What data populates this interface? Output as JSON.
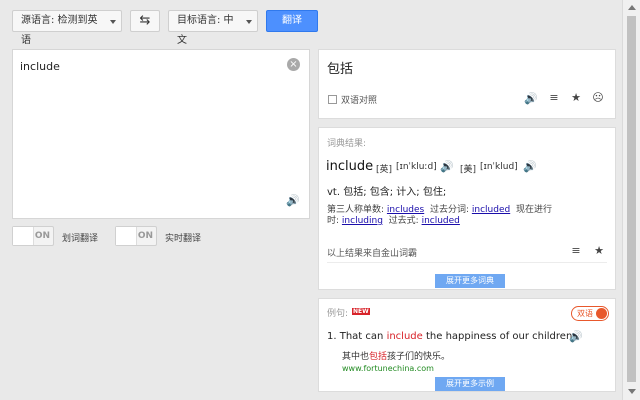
{
  "toolbar": {
    "source_lang": "源语言: 检测到英语",
    "swap_icon": "⇆",
    "target_lang": "目标语言: 中文",
    "translate_label": "翻译"
  },
  "source": {
    "text": "include",
    "clear_icon": "×",
    "speaker_icon": "🔊"
  },
  "options": [
    {
      "toggle": "ON",
      "label": "划词翻译"
    },
    {
      "toggle": "ON",
      "label": "实时翻译"
    }
  ],
  "result": {
    "text": "包括",
    "bilingual_label": "双语对照",
    "speaker_icon": "🔊",
    "list_icon": "≡",
    "star_icon": "★",
    "feedback_icon": "☹"
  },
  "dictionary": {
    "header": "词典结果:",
    "word": "include",
    "uk_label": "[英]",
    "uk_phonetic": "[ɪnˈkluːd]",
    "us_label": "[美]",
    "us_phonetic": "[ɪnˈklud]",
    "definition": "vt. 包括; 包含; 计入; 包住;",
    "forms_line1_a": "第三人称单数:",
    "form_third": "includes",
    "forms_line1_b": "过去分词:",
    "form_pp": "included",
    "forms_line1_c": "现在进行",
    "forms_line2_a": "时:",
    "form_ing": "including",
    "forms_line2_b": "过去式:",
    "form_past": "included",
    "source_note": "以上结果来自金山词霸",
    "more_label": "展开更多词典"
  },
  "examples": {
    "header": "例句:",
    "new_badge": "NEW",
    "bilingual_toggle": "双语",
    "num": "1.",
    "en_before": "That can",
    "en_highlight": "include",
    "en_after": "the happiness of our children.",
    "zh_before": "其中也",
    "zh_highlight": "包括",
    "zh_after": "孩子们的快乐。",
    "source": "www.fortunechina.com",
    "more_label": "展开更多示例"
  },
  "colors": {
    "accent": "#4d90fe",
    "highlight": "#d8232a",
    "link": "#1a0dab",
    "source_green": "#228b22"
  }
}
